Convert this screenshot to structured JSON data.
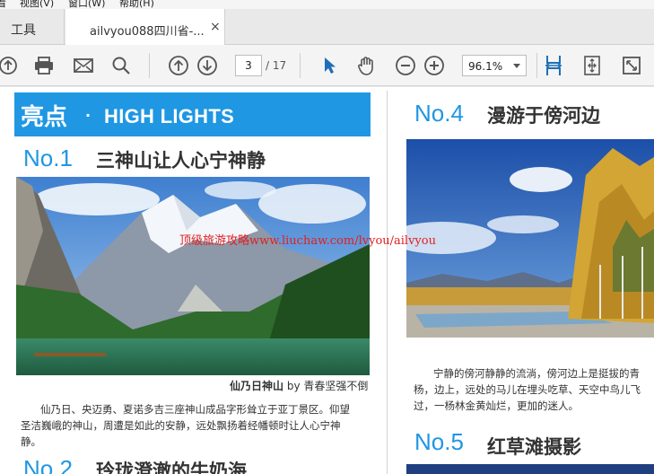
{
  "menu": {
    "items": [
      "看",
      "视图(V)",
      "窗口(W)",
      "帮助(H)"
    ]
  },
  "tabs": {
    "tools": "工具",
    "document": "ailvyou088四川省-...",
    "close": "×"
  },
  "toolbar": {
    "current_page": "3",
    "total_pages": "/ 17",
    "zoom": "96.1%",
    "icons": [
      "upload-icon",
      "print-icon",
      "mail-icon",
      "search-icon",
      "page-up-icon",
      "page-down-icon",
      "select-arrow-icon",
      "hand-icon",
      "zoom-out-icon",
      "zoom-in-icon",
      "fit-width-icon",
      "fit-page-icon",
      "fullscreen-icon"
    ]
  },
  "document": {
    "banner_cn": "亮点",
    "banner_dot": "·",
    "banner_en": "HIGH LIGHTS",
    "sections": [
      {
        "num": "No.1",
        "title": "三神山让人心宁神静"
      },
      {
        "num": "No.2",
        "title": "玲珑澄澈的牛奶海"
      },
      {
        "num": "No.4",
        "title": "漫游于傍河边"
      },
      {
        "num": "No.5",
        "title": "红草滩摄影"
      }
    ],
    "caption_bold": "仙乃日神山",
    "caption_rest": " by 青春坚强不倒",
    "body_left": "仙乃日、央迈勇、夏诺多吉三座神山成品字形耸立于亚丁景区。仰望圣洁巍峨的神山，周遭是如此的安静，远处飘扬着经幡顿时让人心宁神静。",
    "body_right": "宁静的傍河静静的流淌，傍河边上是挺拔的青杨，边上，远处的马儿在埋头吃草、天空中鸟儿飞过，一杨林金黄灿烂，更加的迷人。",
    "watermark": "顶级旅游攻略www.liuchaw.com/lvyou/ailvyou"
  }
}
